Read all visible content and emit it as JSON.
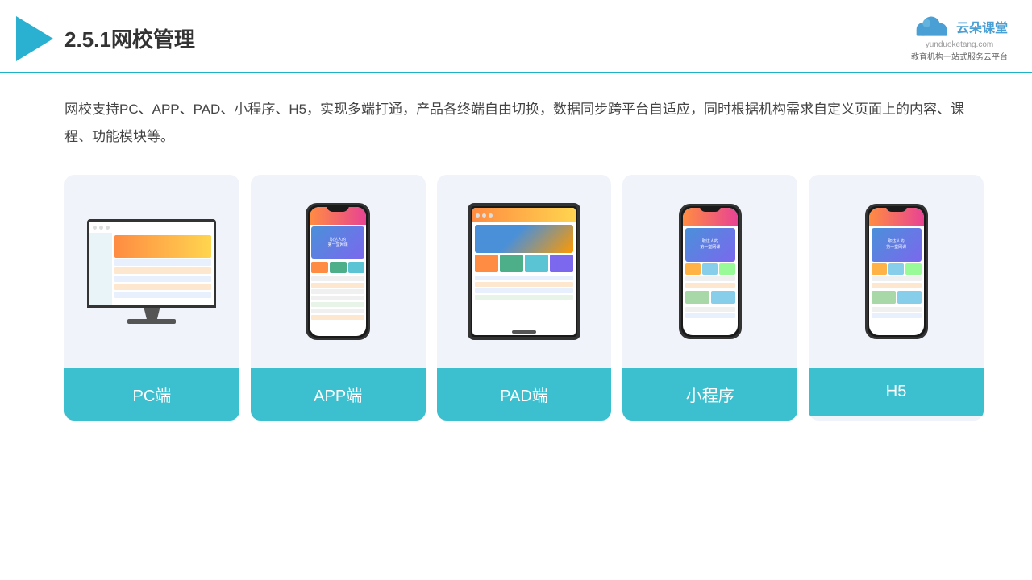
{
  "header": {
    "title": "2.5.1网校管理",
    "brand": {
      "name": "云朵课堂",
      "url": "yunduoketang.com",
      "slogan": "教育机构一站\n式服务云平台"
    }
  },
  "main": {
    "description": "网校支持PC、APP、PAD、小程序、H5，实现多端打通，产品各终端自由切换，数据同步跨平台自适应，同时根据机构需求自定义页面上的内容、课程、功能模块等。"
  },
  "cards": [
    {
      "id": "pc",
      "label": "PC端",
      "device_type": "pc"
    },
    {
      "id": "app",
      "label": "APP端",
      "device_type": "phone"
    },
    {
      "id": "pad",
      "label": "PAD端",
      "device_type": "tablet"
    },
    {
      "id": "miniprogram",
      "label": "小程序",
      "device_type": "phone2"
    },
    {
      "id": "h5",
      "label": "H5",
      "device_type": "phone3"
    }
  ]
}
